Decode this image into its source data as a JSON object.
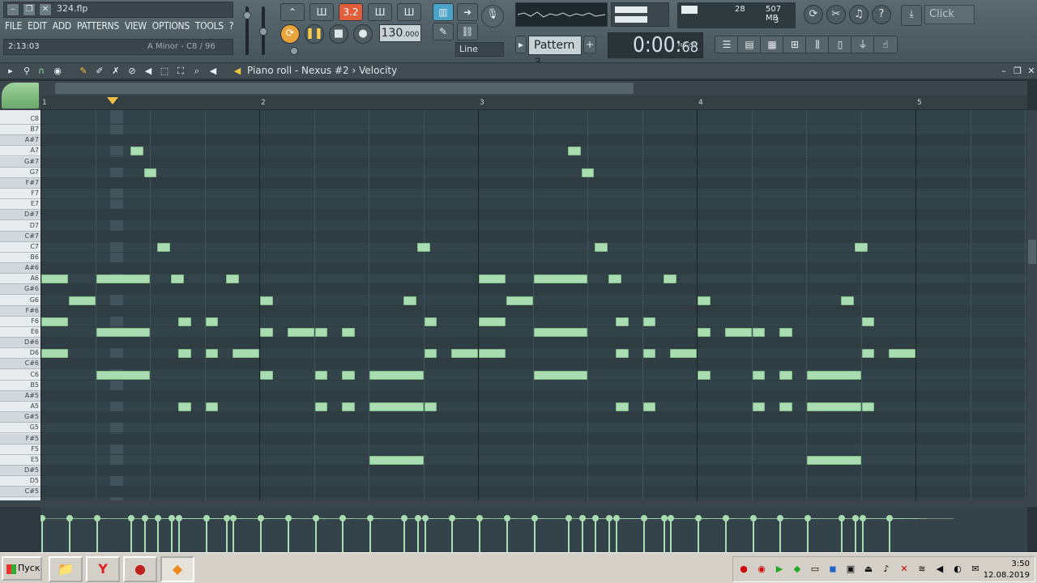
{
  "window": {
    "filename": "324.flp"
  },
  "menu": [
    "FILE",
    "EDIT",
    "ADD",
    "PATTERNS",
    "VIEW",
    "OPTIONS",
    "TOOLS",
    "?"
  ],
  "hint": {
    "time": "2:13:03",
    "text": "A Minor - C8 / 96"
  },
  "transport": {
    "tempo": "130",
    "tempo_frac": ".000",
    "pattern": "Pattern 3",
    "time": "0:00",
    "time_frac": "68",
    "time_unit": "M:S:CS",
    "snap_mode": "Line",
    "step_badge": "3.2"
  },
  "cpu": {
    "value": "28",
    "memory": "507 MB",
    "polyphony": "3"
  },
  "news": "Click",
  "piano_roll": {
    "title": "Piano roll - Nexus #2",
    "separator": "›",
    "target": "Velocity"
  },
  "ruler": [
    "1",
    "2",
    "3",
    "4",
    "5"
  ],
  "keys": [
    "C8",
    "B7",
    "A#7",
    "A7",
    "G#7",
    "G7",
    "F#7",
    "F7",
    "E7",
    "D#7",
    "D7",
    "C#7",
    "C7",
    "B6",
    "A#6",
    "A6",
    "G#6",
    "G6",
    "F#6",
    "F6",
    "E6",
    "D#6",
    "D6",
    "C#6",
    "C6",
    "B5",
    "A#5",
    "A5",
    "G#5",
    "G5",
    "F#5",
    "F5",
    "E5",
    "D#5",
    "D5",
    "C#5"
  ],
  "taskbar": {
    "start": "Пуск",
    "time": "3:50",
    "date": "12.08.2019"
  },
  "colors": {
    "note": "#a9dcb0",
    "grid": "#33434a",
    "accent": "#e25d3a"
  }
}
